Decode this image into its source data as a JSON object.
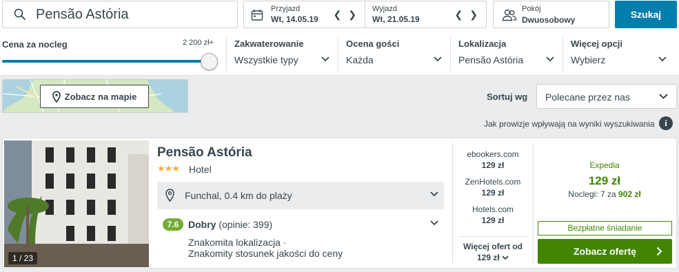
{
  "search": {
    "query": "Pensão Astória"
  },
  "dates": {
    "checkin_label": "Przyjazd",
    "checkin_value": "Wt, 14.05.19",
    "checkout_label": "Wyjazd",
    "checkout_value": "Wt, 21.05.19"
  },
  "guests": {
    "label": "Pokój",
    "value": "Dwuosobowy"
  },
  "search_button": "Szukaj",
  "filters": {
    "price": {
      "label": "Cena za nocleg",
      "max": "2 200 zł+",
      "level": 1.0
    },
    "accommodation": {
      "label": "Zakwaterowanie",
      "value": "Wszystkie typy"
    },
    "rating": {
      "label": "Ocena gości",
      "value": "Każda"
    },
    "location": {
      "label": "Lokalizacja",
      "value": "Pensão Astória"
    },
    "more": {
      "label": "Więcej opcji",
      "value": "Wybierz"
    }
  },
  "map": {
    "button_label": "Zobacz na mapie"
  },
  "sort": {
    "label": "Sortuj wg",
    "value": "Polecane przez nas"
  },
  "commission_note": "Jak prowizje wpływają na wyniki wyszukiwania",
  "info_glyph": "i",
  "result": {
    "photo_count": "1 / 23",
    "name": "Pensão Astória",
    "stars_glyph": "★★★",
    "stars": 3,
    "type": "Hotel",
    "location": "Funchal, 0.4 km do plaży",
    "rating_score": "7.6",
    "rating_word": "Dobry",
    "rating_reviews": "(opinie: 399)",
    "highlights": [
      "Znakomita lokalizacja ·",
      "Znakomity stosunek jakości do ceny"
    ],
    "offers": [
      {
        "site": "ebookers.com",
        "price": "129 zł"
      },
      {
        "site": "ZenHotels.com",
        "price": "129 zł"
      },
      {
        "site": "Hotels.com",
        "price": "129 zł"
      }
    ],
    "more_offers_label": "Więcej ofert od",
    "more_offers_price": "129 zł",
    "best": {
      "site": "Expedia",
      "price": "129 zł",
      "nights_prefix": "Noclegi: 7 za",
      "nights_total": "902 zł",
      "badge": "Bezpłatne śniadanie",
      "button": "Zobacz ofertę"
    }
  },
  "colors": {
    "primary_blue": "#007fad",
    "deal_green": "#428500",
    "rating_green": "#73ad34",
    "star_orange": "#f6ab3f",
    "text": "#37454d"
  }
}
